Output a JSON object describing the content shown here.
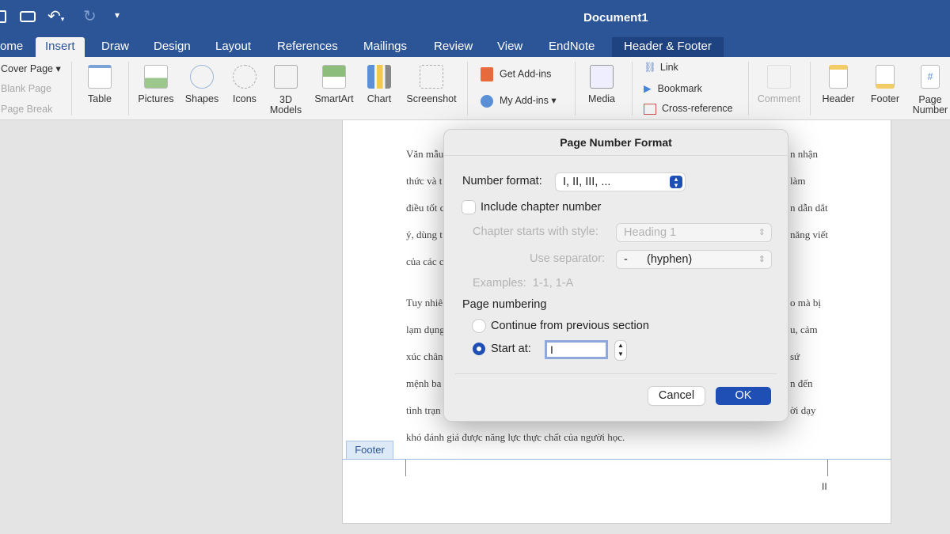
{
  "window": {
    "title": "Document1"
  },
  "tabs": [
    {
      "label": "ome"
    },
    {
      "label": "Insert"
    },
    {
      "label": "Draw"
    },
    {
      "label": "Design"
    },
    {
      "label": "Layout"
    },
    {
      "label": "References"
    },
    {
      "label": "Mailings"
    },
    {
      "label": "Review"
    },
    {
      "label": "View"
    },
    {
      "label": "EndNote"
    },
    {
      "label": "Header & Footer"
    }
  ],
  "ribbon": {
    "pages": [
      "Cover Page",
      "Blank Page",
      "Page Break"
    ],
    "big": [
      "Table",
      "Pictures",
      "Shapes",
      "Icons",
      "3D Models",
      "SmartArt",
      "Chart",
      "Screenshot"
    ],
    "addins": [
      "Get Add-ins",
      "My Add-ins"
    ],
    "media": "Media",
    "links": [
      "Link",
      "Bookmark",
      "Cross-reference"
    ],
    "comment": "Comment",
    "hf": [
      "Header",
      "Footer",
      "Page Number"
    ]
  },
  "document": {
    "left": [
      "Văn mẫu",
      "thức và t",
      "điều tốt c",
      "ý, dùng t",
      "của các c",
      "Tuy nhiê",
      "lạm dụng",
      "xúc chân",
      "mệnh ba",
      "tình trạn"
    ],
    "right": [
      "n nhận",
      "làm",
      "n dẫn dắt",
      "năng viết",
      "",
      "o mà bị",
      "u, cảm",
      "sứ",
      "n đến",
      "ời dạy"
    ],
    "last_line": "khó đánh giá được năng lực thực chất của người học.",
    "footer_label": "Footer",
    "footer_page_number": "II"
  },
  "dialog": {
    "title": "Page Number Format",
    "number_format_label": "Number format:",
    "number_format_value": "I, II, III, ...",
    "include_chapter_label": "Include chapter number",
    "include_chapter_checked": false,
    "chapter_style_label": "Chapter starts with style:",
    "chapter_style_value": "Heading 1",
    "separator_label": "Use separator:",
    "separator_value": "-      (hyphen)",
    "examples_label": "Examples:",
    "examples_value": "1-1, 1-A",
    "page_numbering_label": "Page numbering",
    "continue_label": "Continue from previous section",
    "start_at_label": "Start at:",
    "start_at_value": "I",
    "selected_option": "Start at",
    "cancel_label": "Cancel",
    "ok_label": "OK",
    "accent": "#1f4fb4"
  }
}
